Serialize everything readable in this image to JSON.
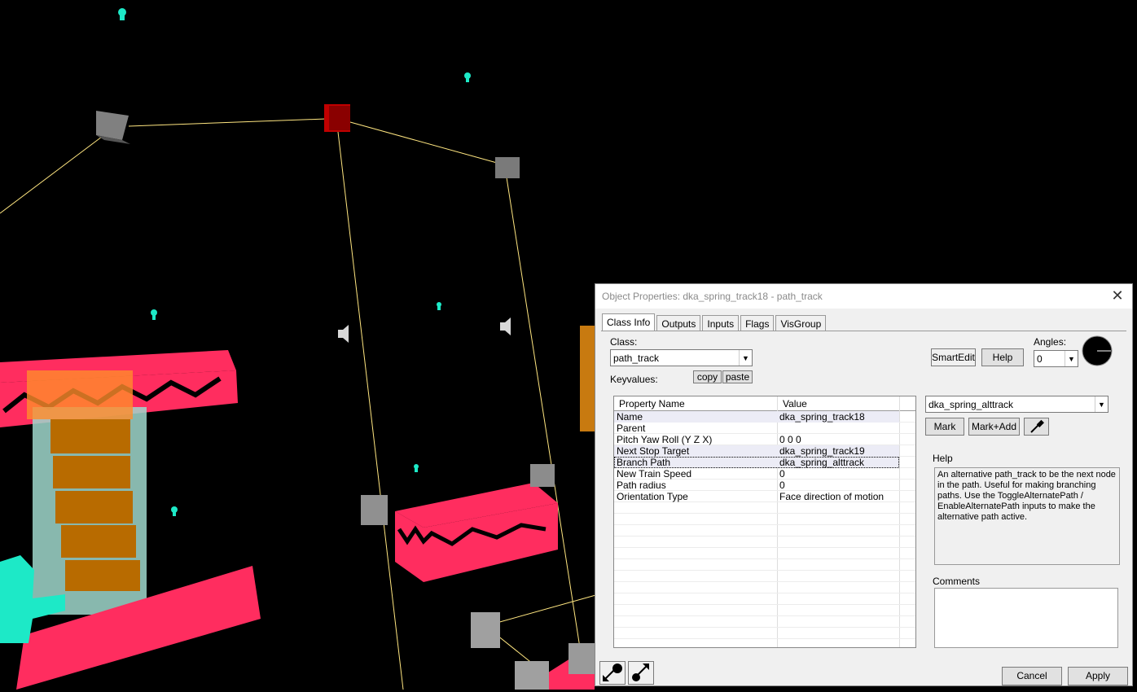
{
  "dialog": {
    "title": "Object Properties: dka_spring_track18 - path_track",
    "close_glyph": "✕",
    "tabs": [
      {
        "label": "Class Info",
        "active": true
      },
      {
        "label": "Outputs"
      },
      {
        "label": "Inputs"
      },
      {
        "label": "Flags"
      },
      {
        "label": "VisGroup"
      }
    ],
    "class_label": "Class:",
    "class_value": "path_track",
    "keyvalues_label": "Keyvalues:",
    "copy_label": "copy",
    "paste_label": "paste",
    "smartedit_label": "SmartEdit",
    "help_button_label": "Help",
    "angles_label": "Angles:",
    "angles_value": "0",
    "grid": {
      "col_name": "Property Name",
      "col_value": "Value",
      "rows": [
        {
          "name": "Name",
          "value": "dka_spring_track18"
        },
        {
          "name": "Parent",
          "value": ""
        },
        {
          "name": "Pitch Yaw Roll (Y Z X)",
          "value": "0 0 0"
        },
        {
          "name": "Next Stop Target",
          "value": "dka_spring_track19"
        },
        {
          "name": "Branch Path",
          "value": "dka_spring_alttrack"
        },
        {
          "name": "New Train Speed",
          "value": "0"
        },
        {
          "name": "Path radius",
          "value": "0"
        },
        {
          "name": "Orientation Type",
          "value": "Face direction of motion"
        }
      ]
    },
    "target_value": "dka_spring_alttrack",
    "mark_label": "Mark",
    "mark_add_label": "Mark+Add",
    "help_title": "Help",
    "help_text": "An alternative path_track to be the next node in the path. Useful for making branching paths. Use the ToggleAlternatePath / EnableAlternatePath inputs to make the alternative path active.",
    "comments_label": "Comments",
    "cancel_label": "Cancel",
    "apply_label": "Apply"
  },
  "colors": {
    "dialog_bg": "#f0f0f0",
    "platform_pink": "#ff2d5f",
    "path_line": "#ffe680",
    "entity_cyan": "#1de9c7",
    "selected_node": "#c00000"
  }
}
